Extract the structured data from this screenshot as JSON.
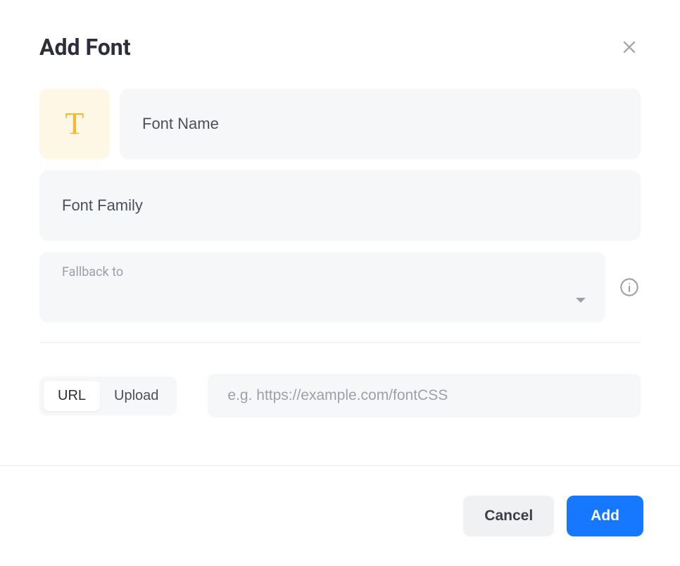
{
  "header": {
    "title": "Add Font"
  },
  "form": {
    "font_name": {
      "value": "",
      "placeholder": "Font Name"
    },
    "font_family": {
      "value": "",
      "placeholder": "Font Family"
    },
    "fallback": {
      "label": "Fallback to",
      "value": ""
    },
    "source_tabs": {
      "url": "URL",
      "upload": "Upload",
      "active": "url"
    },
    "url_input": {
      "value": "",
      "placeholder": "e.g. https://example.com/fontCSS"
    }
  },
  "footer": {
    "cancel_label": "Cancel",
    "add_label": "Add"
  },
  "icons": {
    "font_t": "T"
  }
}
